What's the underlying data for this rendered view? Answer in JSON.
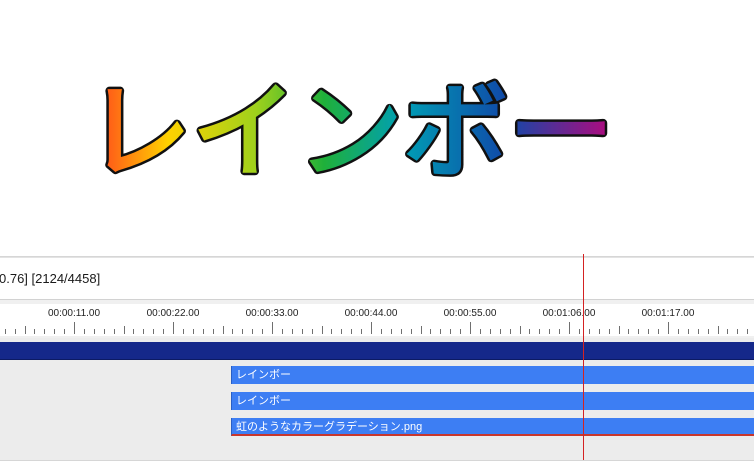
{
  "preview": {
    "title_text": "レインボー",
    "gradient_colors": [
      "#ff3c1e",
      "#ffe400",
      "#22b322",
      "#009fb5",
      "#1049a8",
      "#b00a7e"
    ],
    "outline_color": "#111111"
  },
  "timeline": {
    "status_text": "0.76] [2124/4458]",
    "ruler_labels": [
      "00:00:11.00",
      "00:00:22.00",
      "00:00:33.00",
      "00:00:44.00",
      "00:00:55.00",
      "00:01:06.00",
      "00:01:17.00"
    ],
    "clips": [
      {
        "label": "レインボー"
      },
      {
        "label": "レインボー"
      },
      {
        "label": "虹のようなカラーグラデーション.png"
      }
    ],
    "colors": {
      "clip": "#3d7ef3",
      "scene_bar": "#15288a",
      "cursor": "#d42222",
      "clip_underline": "#c8362c"
    }
  }
}
